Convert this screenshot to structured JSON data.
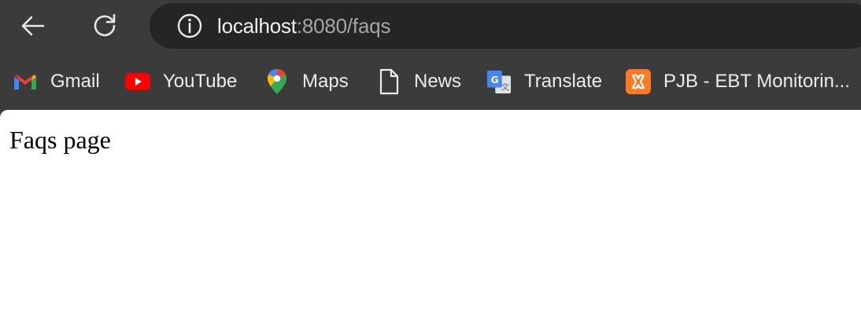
{
  "toolbar": {
    "back_icon": "arrow-left-icon",
    "reload_icon": "reload-icon",
    "site_info_icon": "info-icon"
  },
  "address_bar": {
    "host": "localhost",
    "rest": ":8080/faqs"
  },
  "bookmarks": [
    {
      "label": "Gmail",
      "icon": "gmail-icon"
    },
    {
      "label": "YouTube",
      "icon": "youtube-icon"
    },
    {
      "label": "Maps",
      "icon": "maps-icon"
    },
    {
      "label": "News",
      "icon": "document-icon"
    },
    {
      "label": "Translate",
      "icon": "translate-icon"
    },
    {
      "label": "PJB - EBT Monitorin...",
      "icon": "xampp-icon"
    }
  ],
  "page": {
    "text": "Faqs page"
  },
  "colors": {
    "chrome_background": "#3b3b3b",
    "omnibox_background": "#252525",
    "page_background": "#ffffff",
    "youtube_red": "#ff0000",
    "xampp_orange": "#fb7a24"
  }
}
